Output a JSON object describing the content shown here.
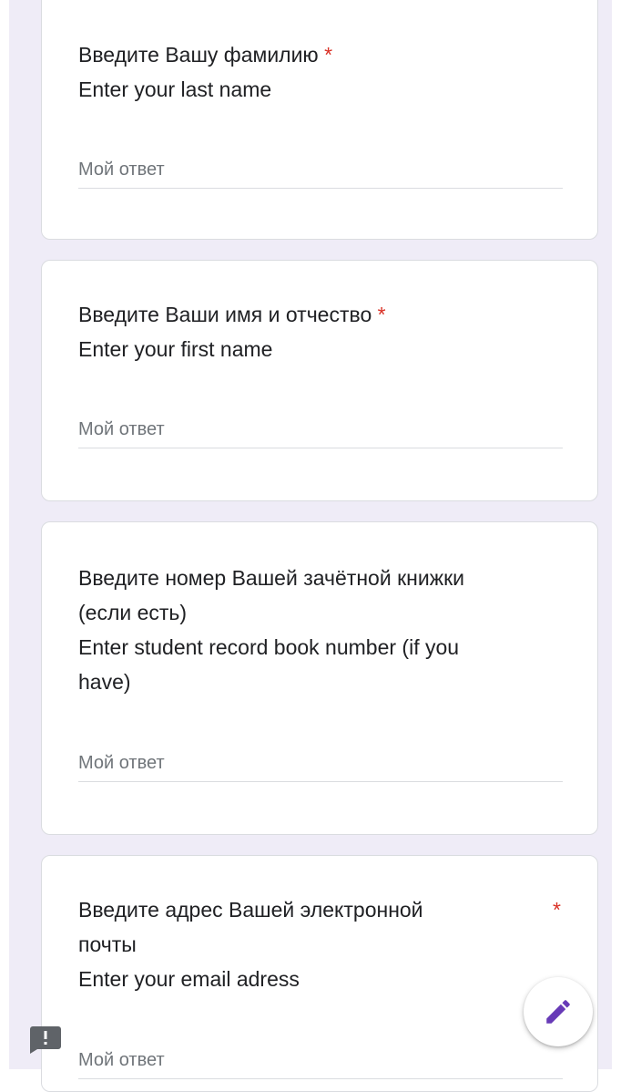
{
  "questions": [
    {
      "title_ru": "Введите Вашу фамилию",
      "title_en": "Enter your last name",
      "required_mark": "*",
      "placeholder": "Мой ответ"
    },
    {
      "title_ru": "Введите Ваши имя и отчество",
      "title_en": "Enter your first name",
      "required_mark": "*",
      "placeholder": "Мой ответ"
    },
    {
      "title_ru_line1": "Введите номер Вашей зачётной книжки",
      "title_ru_line2": "(если есть)",
      "title_en_line1": "Enter student record book number (if you",
      "title_en_line2": "have)",
      "placeholder": "Мой ответ"
    },
    {
      "title_ru_line1": "Введите адрес Вашей электронной",
      "title_ru_line2": "почты",
      "title_en": "Enter your email adress",
      "required_mark": "*",
      "placeholder": "Мой ответ"
    }
  ],
  "icons": {
    "fab": "pencil-icon",
    "feedback": "feedback-icon"
  },
  "colors": {
    "accent": "#673ab7",
    "required": "#d93025",
    "background": "#efecf7"
  }
}
